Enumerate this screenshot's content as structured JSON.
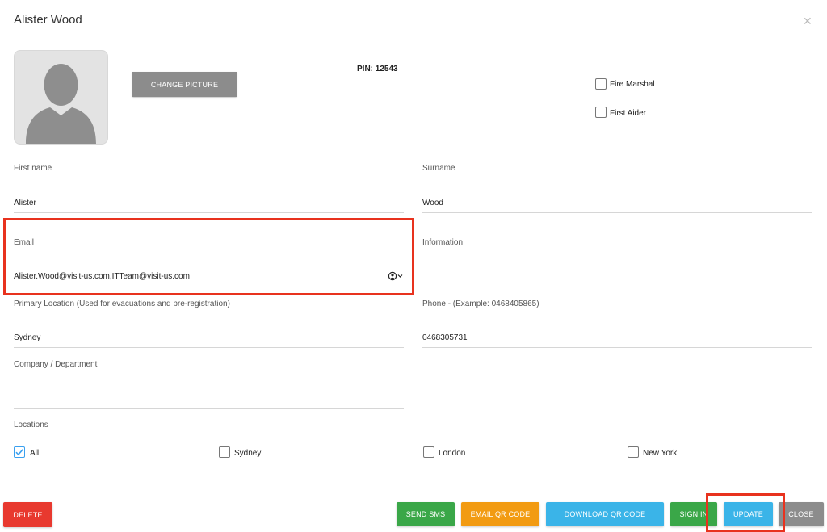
{
  "dialog": {
    "title": "Alister Wood",
    "close_icon": "close-icon"
  },
  "profile": {
    "change_picture_label": "CHANGE PICTURE",
    "pin_label": "PIN:",
    "pin_value": "12543"
  },
  "roles": [
    {
      "label": "Fire Marshal",
      "checked": false
    },
    {
      "label": "First Aider",
      "checked": false
    }
  ],
  "fields": {
    "first_name": {
      "label": "First name",
      "value": "Alister"
    },
    "surname": {
      "label": "Surname",
      "value": "Wood"
    },
    "email": {
      "label": "Email",
      "value": "Alister.Wood@visit-us.com,ITTeam@visit-us.com"
    },
    "information": {
      "label": "Information",
      "value": ""
    },
    "primary_location": {
      "label": "Primary Location (Used for evacuations and pre-registration)",
      "value": "Sydney"
    },
    "phone": {
      "label": "Phone - (Example: 0468405865)",
      "value": "0468305731"
    },
    "company": {
      "label": "Company / Department",
      "value": ""
    }
  },
  "locations": {
    "label": "Locations",
    "items": [
      {
        "label": "All",
        "checked": true
      },
      {
        "label": "Sydney",
        "checked": false
      },
      {
        "label": "London",
        "checked": false
      },
      {
        "label": "New York",
        "checked": false
      }
    ]
  },
  "footer": {
    "delete_label": "DELETE",
    "send_sms_label": "SEND SMS",
    "email_qr_label": "EMAIL QR CODE",
    "download_qr_label": "DOWNLOAD QR CODE",
    "sign_in_label": "SIGN IN",
    "update_label": "UPDATE",
    "close_label": "CLOSE"
  },
  "colors": {
    "accent": "#3aa0ef",
    "highlight": "#e8321e",
    "delete": "#e8392f",
    "green": "#3aa748",
    "orange": "#f29b12",
    "blue": "#3ab4e8",
    "grey": "#8c8c8c"
  }
}
